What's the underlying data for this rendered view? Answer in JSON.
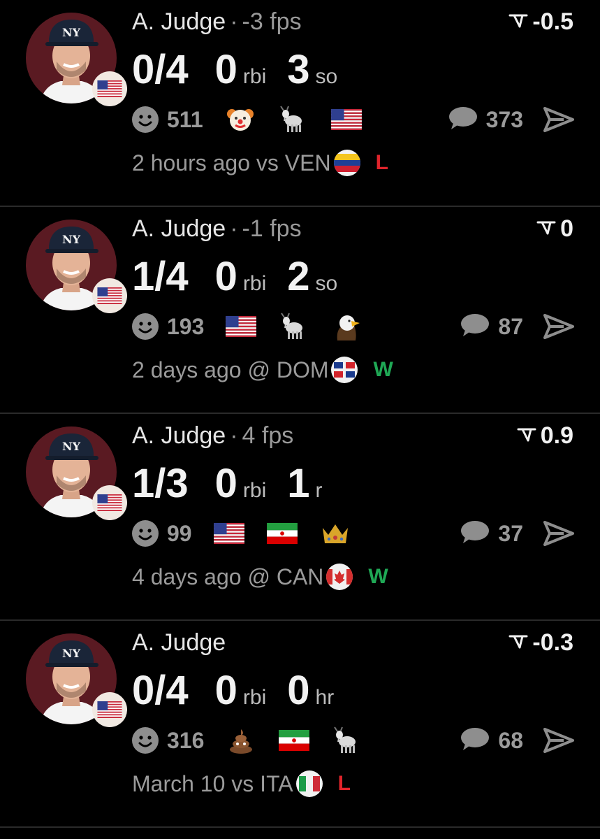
{
  "colors": {
    "win": "#1fa855",
    "loss": "#e0242b",
    "background": "#000000",
    "muted": "#9a9a9a"
  },
  "cards": [
    {
      "name": "A. Judge",
      "fps": "-3 fps",
      "rating": "-0.5",
      "stats": [
        {
          "value": "0/4",
          "unit": ""
        },
        {
          "value": "0",
          "unit": "rbi"
        },
        {
          "value": "3",
          "unit": "so"
        }
      ],
      "reaction_count": "511",
      "emojis": [
        "clown-emoji",
        "goat-emoji",
        "us-flag-emoji"
      ],
      "comments": "373",
      "game": "2 hours ago vs VEN",
      "opponent_flag": "venezuela-flag-icon",
      "result": "L"
    },
    {
      "name": "A. Judge",
      "fps": "-1 fps",
      "rating": "0",
      "stats": [
        {
          "value": "1/4",
          "unit": ""
        },
        {
          "value": "0",
          "unit": "rbi"
        },
        {
          "value": "2",
          "unit": "so"
        }
      ],
      "reaction_count": "193",
      "emojis": [
        "us-flag-emoji",
        "goat-emoji",
        "eagle-emoji"
      ],
      "comments": "87",
      "game": "2 days ago @ DOM",
      "opponent_flag": "dominican-flag-icon",
      "result": "W"
    },
    {
      "name": "A. Judge",
      "fps": "4 fps",
      "rating": "0.9",
      "stats": [
        {
          "value": "1/3",
          "unit": ""
        },
        {
          "value": "0",
          "unit": "rbi"
        },
        {
          "value": "1",
          "unit": "r"
        }
      ],
      "reaction_count": "99",
      "emojis": [
        "us-flag-emoji",
        "iran-flag-emoji",
        "crown-emoji"
      ],
      "comments": "37",
      "game": "4 days ago @ CAN",
      "opponent_flag": "canada-flag-icon",
      "result": "W"
    },
    {
      "name": "A. Judge",
      "fps": "",
      "rating": "-0.3",
      "stats": [
        {
          "value": "0/4",
          "unit": ""
        },
        {
          "value": "0",
          "unit": "rbi"
        },
        {
          "value": "0",
          "unit": "hr"
        }
      ],
      "reaction_count": "316",
      "emojis": [
        "poop-emoji",
        "iran-flag-emoji",
        "goat-emoji"
      ],
      "comments": "68",
      "game": "March 10 vs ITA",
      "opponent_flag": "italy-flag-icon",
      "result": "L"
    }
  ]
}
